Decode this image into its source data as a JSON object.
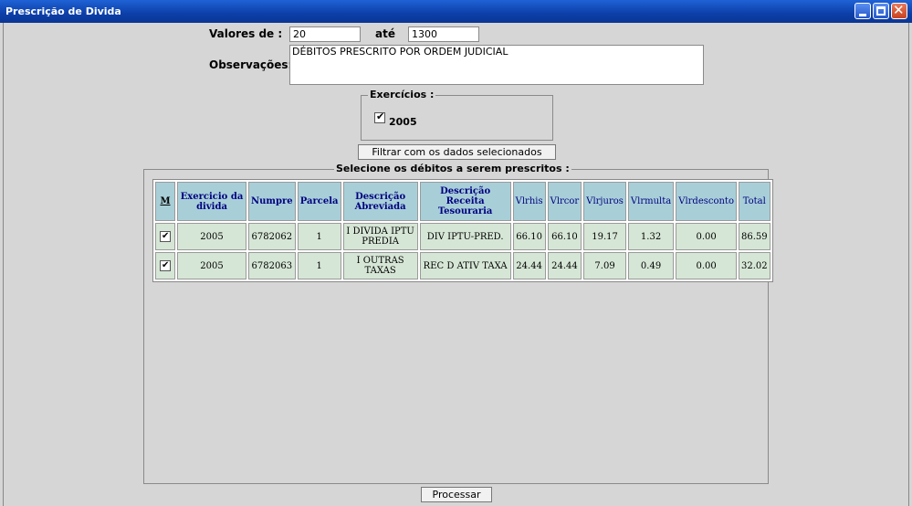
{
  "window": {
    "title": "Prescrição de Divida"
  },
  "form": {
    "valores_label": "Valores de :",
    "valor_min": "20",
    "ate_label": "até",
    "valor_max": "1300",
    "observacoes_label": "Observações:",
    "observacoes_value": "DÉBITOS PRESCRITO POR ORDEM JUDICIAL"
  },
  "exercicios": {
    "legend": "Exercícios :",
    "items": [
      {
        "label": "2005",
        "checked": true
      }
    ]
  },
  "filter_button": "Filtrar com os dados selecionados",
  "debitos": {
    "legend": "Selecione os débitos a serem prescritos :",
    "headers": {
      "m": "M",
      "exercicio": "Exercicio da divida",
      "numpre": "Numpre",
      "parcela": "Parcela",
      "descricao_abrev": "Descrição Abreviada",
      "descricao_receita": "Descrição Receita Tesouraria",
      "vlrhis": "Vlrhis",
      "vlrcor": "Vlrcor",
      "vlrjuros": "Vlrjuros",
      "vlrmulta": "Vlrmulta",
      "vlrdesconto": "Vlrdesconto",
      "total": "Total"
    },
    "rows": [
      {
        "checked": true,
        "exercicio": "2005",
        "numpre": "6782062",
        "parcela": "1",
        "descricao_abrev": "I DIVIDA IPTU PREDIA",
        "descricao_receita": "DIV IPTU-PRED.",
        "vlrhis": "66.10",
        "vlrcor": "66.10",
        "vlrjuros": "19.17",
        "vlrmulta": "1.32",
        "vlrdesconto": "0.00",
        "total": "86.59"
      },
      {
        "checked": true,
        "exercicio": "2005",
        "numpre": "6782063",
        "parcela": "1",
        "descricao_abrev": "I OUTRAS TAXAS",
        "descricao_receita": "REC D ATIV TAXA",
        "vlrhis": "24.44",
        "vlrcor": "24.44",
        "vlrjuros": "7.09",
        "vlrmulta": "0.49",
        "vlrdesconto": "0.00",
        "total": "32.02"
      }
    ]
  },
  "process_button": "Processar",
  "colors": {
    "titlebar": "#0c3fa8",
    "header_bg": "#a8cfd8",
    "header_text": "#000080",
    "cell_bg": "#d6e6d6",
    "window_bg": "#d6d6d6"
  }
}
